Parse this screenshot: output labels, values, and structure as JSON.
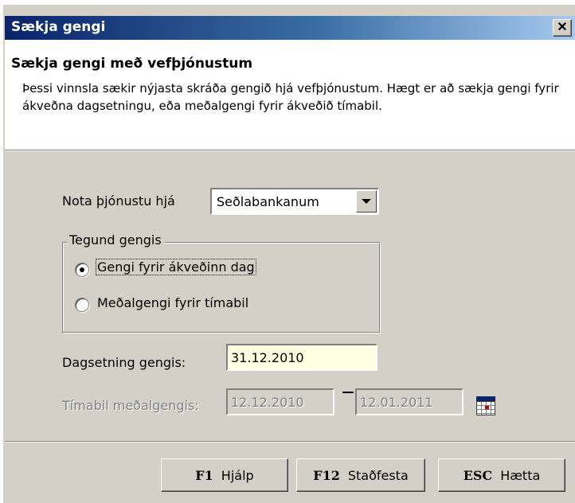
{
  "window": {
    "title": "Sækja gengi",
    "close_glyph": "✕"
  },
  "header": {
    "title": "Sækja gengi með vefþjónustum",
    "description": "Þessi vinnsla sækir nýjasta skráða gengið hjá vefþjónustum.  Hægt er að sækja gengi fyrir ákveðna dagsetningu, eða meðalgengi fyrir ákveðið tímabil."
  },
  "service": {
    "label": "Nota þjónustu hjá",
    "selected": "Seðlabankanum"
  },
  "rate_type": {
    "legend": "Tegund gengis",
    "options": [
      {
        "label": "Gengi fyrir ákveðinn dag",
        "selected": true
      },
      {
        "label": "Meðalgengi fyrir tímabil",
        "selected": false
      }
    ]
  },
  "date": {
    "label": "Dagsetning gengis:",
    "value": "31.12.2010"
  },
  "period": {
    "label": "Tímabil meðalgengis:",
    "from": "12.12.2010",
    "to": "12.01.2011",
    "calendar_icon": "calendar-icon"
  },
  "buttons": {
    "help": {
      "key": "F1",
      "label": "Hjálp"
    },
    "confirm": {
      "key": "F12",
      "label": "Staðfesta"
    },
    "cancel": {
      "key": "ESC",
      "label": "Hætta"
    }
  },
  "colors": {
    "titlebar_start": "#0a246a",
    "titlebar_end": "#a6caf0",
    "dialog_bg": "#d4d0c8",
    "active_field_bg": "#ffffe1"
  }
}
